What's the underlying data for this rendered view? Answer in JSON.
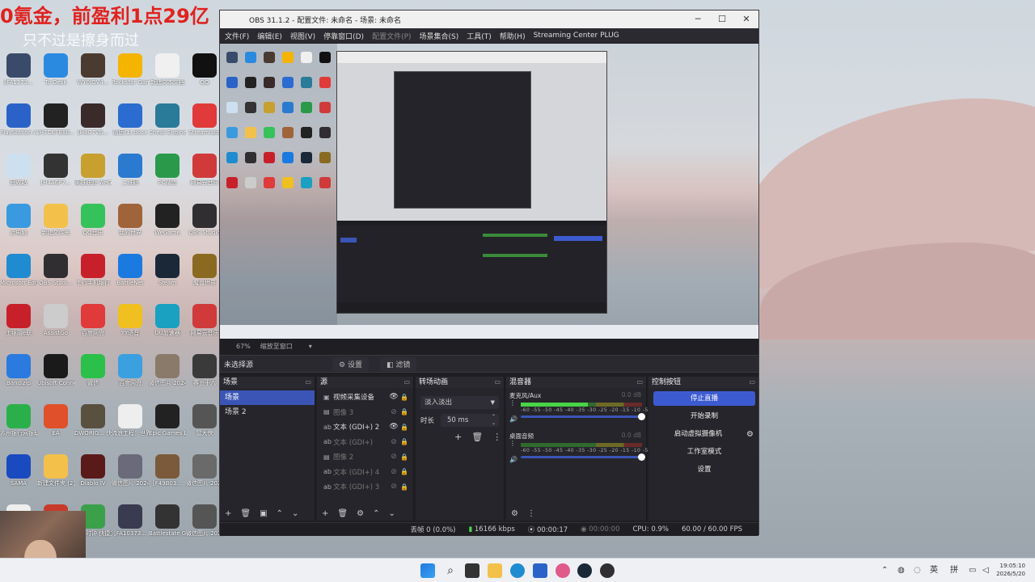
{
  "overlay": {
    "title": "0氪金，前盈利1点29亿",
    "subtitle": "只不过是擦身而过"
  },
  "desktop_icons": [
    {
      "label": "[FA1373...",
      "color": "#3a4a6a"
    },
    {
      "label": "To Desk",
      "color": "#2a8ae0"
    },
    {
      "label": "WY0IOV4...",
      "color": "#4a3a30"
    },
    {
      "label": "Rockstar Games...",
      "color": "#f4b400"
    },
    {
      "label": "新建文本文档",
      "color": "#f0f0f0"
    },
    {
      "label": "QQ",
      "color": "#111"
    },
    {
      "label": "PlayStation Accessories",
      "color": "#2a62c8"
    },
    {
      "label": "[H7C67B8B...",
      "color": "#222"
    },
    {
      "label": "[H8C7VB...",
      "color": "#3a2a2a"
    },
    {
      "label": "简历(1).docx",
      "color": "#2b6cd0"
    },
    {
      "label": "Cheat Engine.exe",
      "color": "#2a7a9a"
    },
    {
      "label": "Streamlabs",
      "color": "#e03a3a"
    },
    {
      "label": "回收站",
      "color": "#cde0f0"
    },
    {
      "label": "[H4A6P7...",
      "color": "#333"
    },
    {
      "label": "英雄联盟 WeGame版",
      "color": "#c8a030"
    },
    {
      "label": "二维码",
      "color": "#2a7ad0"
    },
    {
      "label": "PC微信",
      "color": "#2a9a4a"
    },
    {
      "label": "网易云音乐",
      "color": "#d03a3a"
    },
    {
      "label": "此电脑",
      "color": "#3a9ae0"
    },
    {
      "label": "新建文件夹",
      "color": "#f3c14a"
    },
    {
      "label": "QQ音乐",
      "color": "#36c25a"
    },
    {
      "label": "我的世界",
      "color": "#a0643a"
    },
    {
      "label": "WeGame",
      "color": "#222"
    },
    {
      "label": "OBS Studio",
      "color": "#302e31"
    },
    {
      "label": "Microsoft Edge",
      "color": "#1f8bd0"
    },
    {
      "label": "OBS Studi...",
      "color": "#302e31"
    },
    {
      "label": "工行手机银行",
      "color": "#c8202a"
    },
    {
      "label": "BattleNet",
      "color": "#1a7ae0"
    },
    {
      "label": "Steam",
      "color": "#1b2838"
    },
    {
      "label": "魔兽世界",
      "color": "#8a6a20"
    },
    {
      "label": "工银融e联",
      "color": "#c8202a"
    },
    {
      "label": "AssistGo",
      "color": "#ccc"
    },
    {
      "label": "百度网盘",
      "color": "#e03a3a"
    },
    {
      "label": "YY语音",
      "color": "#f0c020"
    },
    {
      "label": "UU加速器",
      "color": "#1aa0c0"
    },
    {
      "label": "网易云音乐",
      "color": "#d03a3a"
    },
    {
      "label": "Bandizip",
      "color": "#2a7ae0"
    },
    {
      "label": "Ubisoft Connect",
      "color": "#1a1a1a"
    },
    {
      "label": "微信",
      "color": "#2ac04a"
    },
    {
      "label": "百度网盘",
      "color": "#3aa0e0"
    },
    {
      "label": "微信图片 2024082...",
      "color": "#8a7a6a"
    },
    {
      "label": "赛五十六",
      "color": "#3a3a3a"
    },
    {
      "label": "苏州银行网银助手",
      "color": "#2ab04a"
    },
    {
      "label": "EA",
      "color": "#e0502a"
    },
    {
      "label": "DWORIG... 快捷方式",
      "color": "#5a5040"
    },
    {
      "label": "流浪工程：世界",
      "color": "#eee"
    },
    {
      "label": "Epic Games Launcher",
      "color": "#222"
    },
    {
      "label": "鼠大侠",
      "color": "#555"
    },
    {
      "label": "SAMA",
      "color": "#1a4ac0"
    },
    {
      "label": "新建文件夹 (2)",
      "color": "#f3c14a"
    },
    {
      "label": "Diablo IV",
      "color": "#5a1a1a"
    },
    {
      "label": "微信图片 2024082...",
      "color": "#6a6a7a"
    },
    {
      "label": "[F49B03...",
      "color": "#7a5a3a"
    },
    {
      "label": "微信图片 2024082...",
      "color": "#6a6a6a"
    },
    {
      "label": "",
      "color": "#eee"
    },
    {
      "label": "",
      "color": "#c83a2a"
    },
    {
      "label": "石榴时钟 快捷方式",
      "color": "#3aa04a"
    },
    {
      "label": "[FA10373...",
      "color": "#3a3a50"
    },
    {
      "label": "Battlestate Games L...",
      "color": "#333"
    },
    {
      "label": "微信图片 2026042...",
      "color": "#555"
    }
  ],
  "obs": {
    "window_title": "OBS 31.1.2 - 配置文件: 未命名 - 场景: 未命名",
    "menu": [
      "文件(F)",
      "编辑(E)",
      "视图(V)",
      "停靠窗口(D)",
      "配置文件(P)",
      "场景集合(S)",
      "工具(T)",
      "帮助(H)",
      "Streaming Center PLUG"
    ],
    "preview_status": {
      "zoom": "67%",
      "mode": "缩放至窗口"
    },
    "context": {
      "label": "未选择源",
      "settings": "设置",
      "filters": "滤镜"
    },
    "scenes": {
      "title": "场景",
      "items": [
        "场景",
        "场景 2"
      ],
      "selected": 0
    },
    "sources": {
      "title": "源",
      "items": [
        {
          "type": "▣",
          "name": "视频采集设备",
          "visible": true
        },
        {
          "type": "▤",
          "name": "图像 3",
          "visible": false
        },
        {
          "type": "ab",
          "name": "文本 (GDI+) 2",
          "visible": true
        },
        {
          "type": "ab",
          "name": "文本 (GDI+)",
          "visible": false
        },
        {
          "type": "▤",
          "name": "图像 2",
          "visible": false
        },
        {
          "type": "ab",
          "name": "文本 (GDI+) 4",
          "visible": false
        },
        {
          "type": "ab",
          "name": "文本 (GDI+) 3",
          "visible": false
        }
      ]
    },
    "transitions": {
      "title": "转场动画",
      "selected": "淡入淡出",
      "duration_label": "时长",
      "duration": "50 ms"
    },
    "mixer": {
      "title": "混音器",
      "channels": [
        {
          "name": "麦克风/Aux",
          "db": "0.0 dB",
          "level": 0.55
        },
        {
          "name": "桌面音频",
          "db": "0.0 dB",
          "level": 0.0
        }
      ],
      "ticks": "-60 -55 -50 -45 -40 -35 -30 -25 -20 -15 -10 -5 0"
    },
    "controls": {
      "title": "控制按钮",
      "stop_stream": "停止直播",
      "start_record": "开始录制",
      "virtual_cam": "启动虚拟摄像机",
      "studio_mode": "工作室模式",
      "settings": "设置"
    },
    "status": {
      "dropped": "丢帧 0 (0.0%)",
      "bitrate": "16166 kbps",
      "stream_time": "00:00:17",
      "record_time": "00:00:00",
      "cpu": "CPU: 0.9%",
      "fps": "60.00 / 60.00 FPS"
    }
  },
  "taskbar": {
    "ime_lang": "英",
    "ime_mode": "拼",
    "time": "19:05:10",
    "date": "2026/5/20"
  }
}
